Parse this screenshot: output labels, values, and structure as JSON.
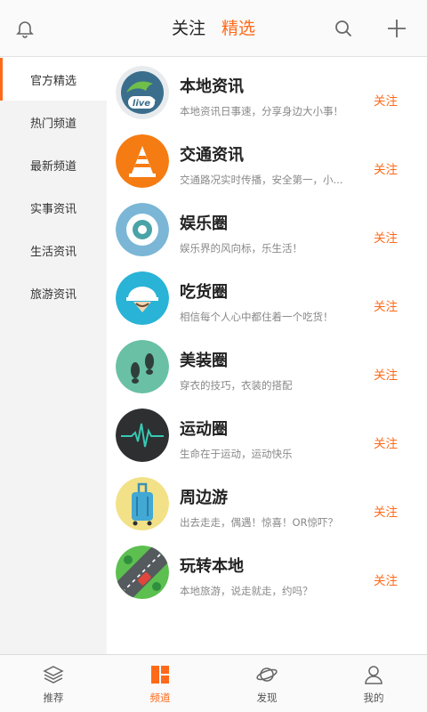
{
  "header": {
    "tab_follow": "关注",
    "tab_selected": "精选",
    "icons": [
      "bell-icon",
      "search-icon",
      "plus-icon"
    ],
    "accent_color": "#ff6a1a"
  },
  "sidebar": {
    "items": [
      {
        "label": "官方精选",
        "active": true
      },
      {
        "label": "热门频道"
      },
      {
        "label": "最新频道"
      },
      {
        "label": "实事资讯"
      },
      {
        "label": "生活资讯"
      },
      {
        "label": "旅游资讯"
      }
    ]
  },
  "channels": [
    {
      "title": "本地资讯",
      "desc": "本地资讯日事速，分享身边大小事！",
      "follow": "关注",
      "icon": "live-globe-icon"
    },
    {
      "title": "交通资讯",
      "desc": "交通路况实时传播，安全第一，小...",
      "follow": "关注",
      "icon": "traffic-cone-icon"
    },
    {
      "title": "娱乐圈",
      "desc": "娱乐界的风向标，乐生活！",
      "follow": "关注",
      "icon": "eye-icon"
    },
    {
      "title": "吃货圈",
      "desc": "相信每个人心中都住着一个吃货！",
      "follow": "关注",
      "icon": "chef-hat-icon"
    },
    {
      "title": "美装圈",
      "desc": "穿衣的技巧，衣装的搭配",
      "follow": "关注",
      "icon": "footprints-icon"
    },
    {
      "title": "运动圈",
      "desc": "生命在于运动，运动快乐",
      "follow": "关注",
      "icon": "heartbeat-icon"
    },
    {
      "title": "周边游",
      "desc": "出去走走，偶遇！惊喜！OR惊吓？",
      "follow": "关注",
      "icon": "suitcase-icon"
    },
    {
      "title": "玩转本地",
      "desc": "本地旅游，说走就走，约吗？",
      "follow": "关注",
      "icon": "road-car-icon"
    }
  ],
  "bottom_nav": {
    "items": [
      {
        "label": "推荐",
        "icon": "layers-icon"
      },
      {
        "label": "频道",
        "icon": "grid-icon",
        "active": true
      },
      {
        "label": "发现",
        "icon": "planet-icon"
      },
      {
        "label": "我的",
        "icon": "person-icon"
      }
    ]
  }
}
